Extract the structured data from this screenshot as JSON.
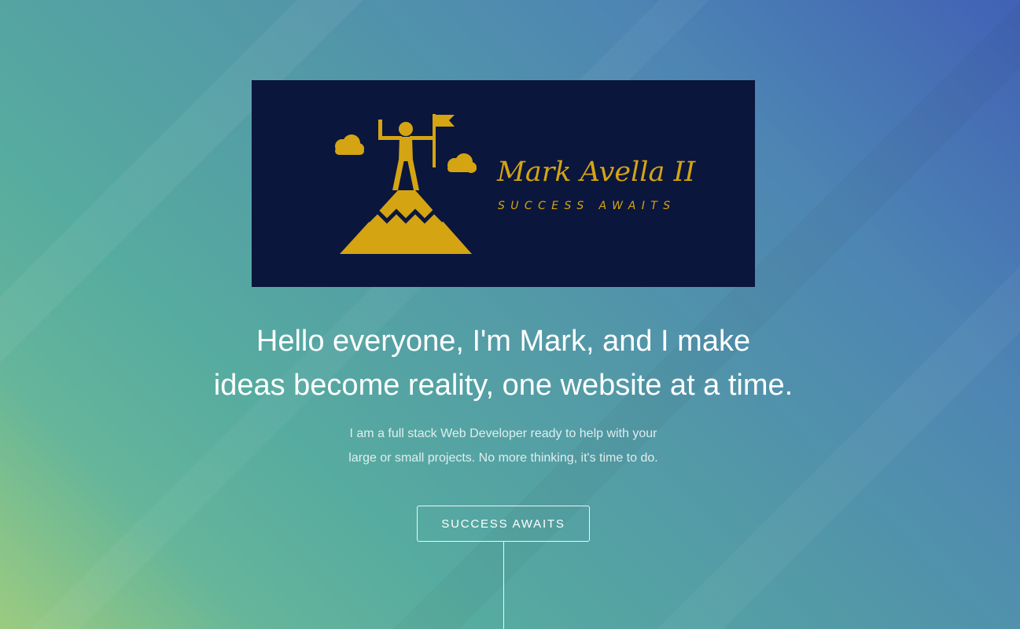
{
  "logo": {
    "title": "Mark Avella II",
    "tagline": "SUCCESS AWAITS",
    "icon": "mountain-summit-flag-icon",
    "background_color": "#0b163c",
    "accent_color": "#d4a413"
  },
  "hero": {
    "headline_before": "Hello everyone, I'm ",
    "headline_name": "Mark",
    "headline_line1_after": ", and I make",
    "headline_line2": "ideas become reality, one website at a time.",
    "subtext_line1": "I am a full stack Web Developer ready to help with your",
    "subtext_line2": "large or small projects. No more thinking, it's time to do.",
    "cta_label": "SUCCESS AWAITS"
  },
  "colors": {
    "gradient_top_right": "#4161b5",
    "gradient_bottom_left": "#9ccb80",
    "text": "#ffffff"
  }
}
